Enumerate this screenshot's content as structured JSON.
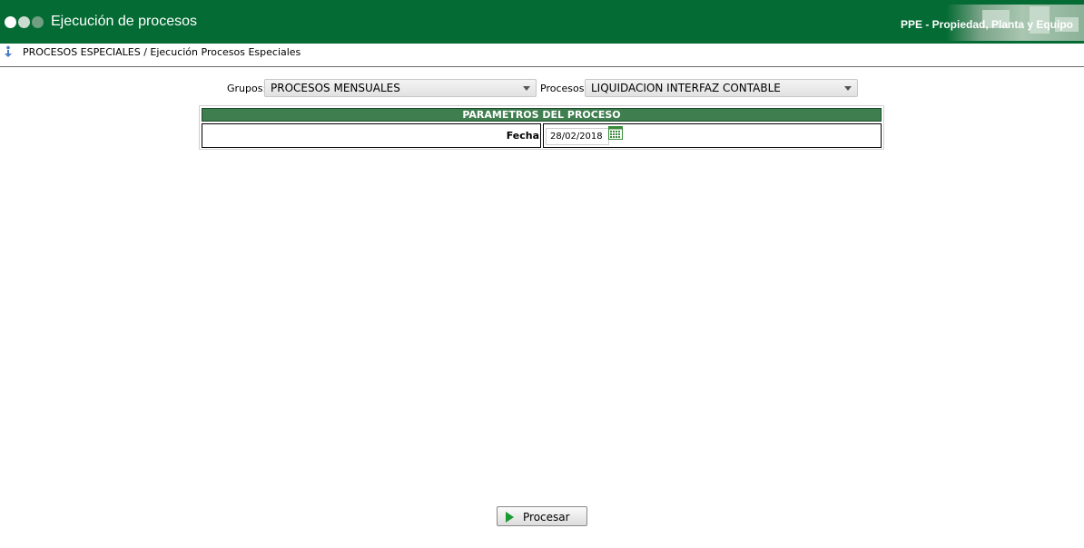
{
  "header": {
    "title": "Ejecución de procesos",
    "app_name": "PPE - Propiedad, Planta y Equipo",
    "color": "#036b33"
  },
  "breadcrumb": {
    "icon": "info-down-arrow-icon",
    "text": "PROCESOS ESPECIALES / Ejecución Procesos Especiales"
  },
  "filters": {
    "grupos_label": "Grupos:",
    "grupos_value": "PROCESOS MENSUALES",
    "procesos_label": "Procesos:",
    "procesos_value": "LIQUIDACION INTERFAZ CONTABLE"
  },
  "params": {
    "heading": "PARAMETROS DEL PROCESO",
    "heading_color": "#3f7e4f",
    "fecha_label": "Fecha",
    "fecha_value": "28/02/2018",
    "calendar_icon": "calendar-icon"
  },
  "actions": {
    "procesar_label": "Procesar",
    "procesar_icon": "play-icon"
  }
}
